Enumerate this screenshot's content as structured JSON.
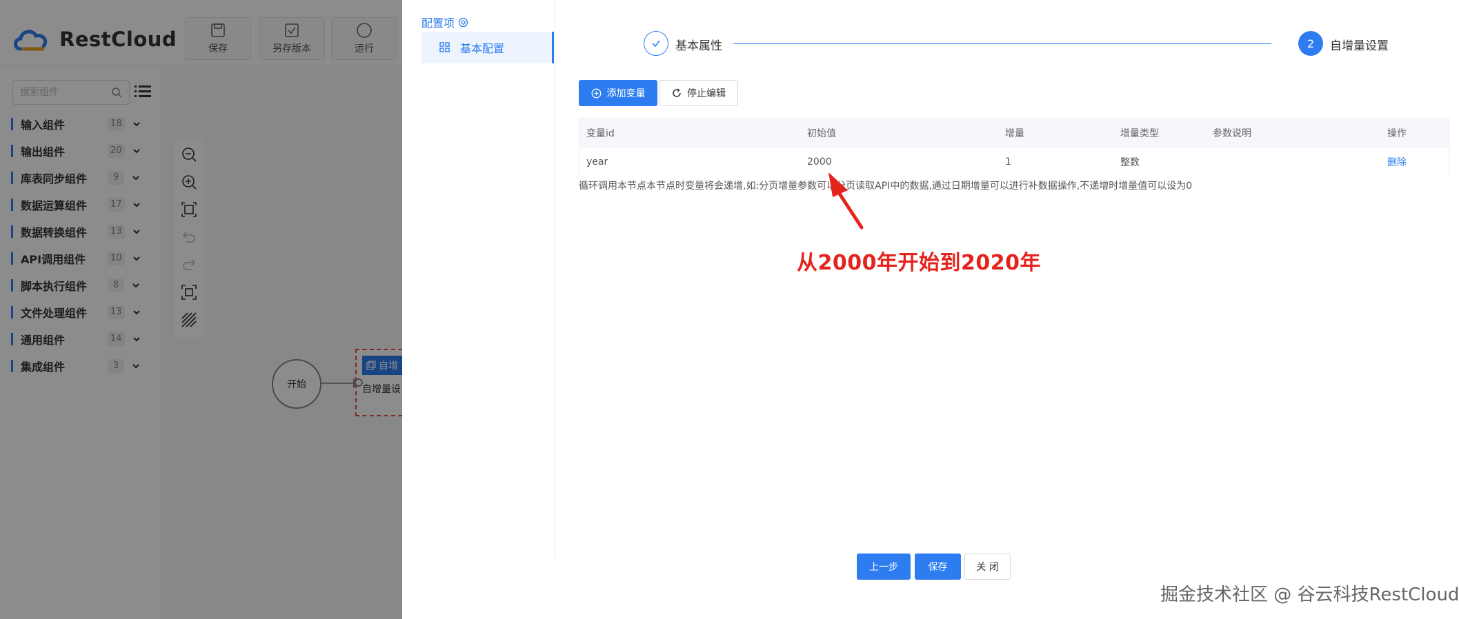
{
  "app": {
    "logo_text": "RestCloud",
    "toolbar": [
      {
        "label": "保存",
        "icon": "save-icon"
      },
      {
        "label": "另存版本",
        "icon": "save-version-icon"
      },
      {
        "label": "运行",
        "icon": "run-icon"
      }
    ],
    "search": {
      "placeholder": "搜索组件"
    },
    "categories": [
      {
        "label": "输入组件",
        "count": "18"
      },
      {
        "label": "输出组件",
        "count": "20"
      },
      {
        "label": "库表同步组件",
        "count": "9"
      },
      {
        "label": "数据运算组件",
        "count": "17"
      },
      {
        "label": "数据转换组件",
        "count": "13"
      },
      {
        "label": "API调用组件",
        "count": "10"
      },
      {
        "label": "脚本执行组件",
        "count": "8"
      },
      {
        "label": "文件处理组件",
        "count": "13"
      },
      {
        "label": "通用组件",
        "count": "14"
      },
      {
        "label": "集成组件",
        "count": "3"
      }
    ],
    "canvas": {
      "start_node": "开始",
      "proc_node_title": "自增",
      "proc_node_body": "自增量设"
    }
  },
  "drawer": {
    "config_title": "配置项",
    "nav_item": "基本配置",
    "steps": [
      {
        "label": "基本属性",
        "state": "done"
      },
      {
        "number": "2",
        "label": "自增量设置",
        "state": "active"
      }
    ],
    "buttons": {
      "add_variable": "添加变量",
      "stop_edit": "停止编辑",
      "prev": "上一步",
      "save": "保存",
      "close": "关 闭"
    },
    "table": {
      "columns": [
        "变量id",
        "初始值",
        "增量",
        "增量类型",
        "参数说明",
        "操作"
      ],
      "rows": [
        {
          "id": "year",
          "initial": "2000",
          "increment": "1",
          "type": "整数",
          "desc": "",
          "action": "删除"
        }
      ]
    },
    "hint": "循环调用本节点本节点时变量将会递增,如:分页增量参数可以分页读取API中的数据,通过日期增量可以进行补数据操作,不递增时增量值可以设为0",
    "annotation": "从2000年开始到2020年",
    "annotation_color": "#e5231d"
  },
  "watermark": "掘金技术社区 @ 谷云科技RestCloud",
  "colors": {
    "primary": "#2d7cf0",
    "danger": "#e54848"
  }
}
